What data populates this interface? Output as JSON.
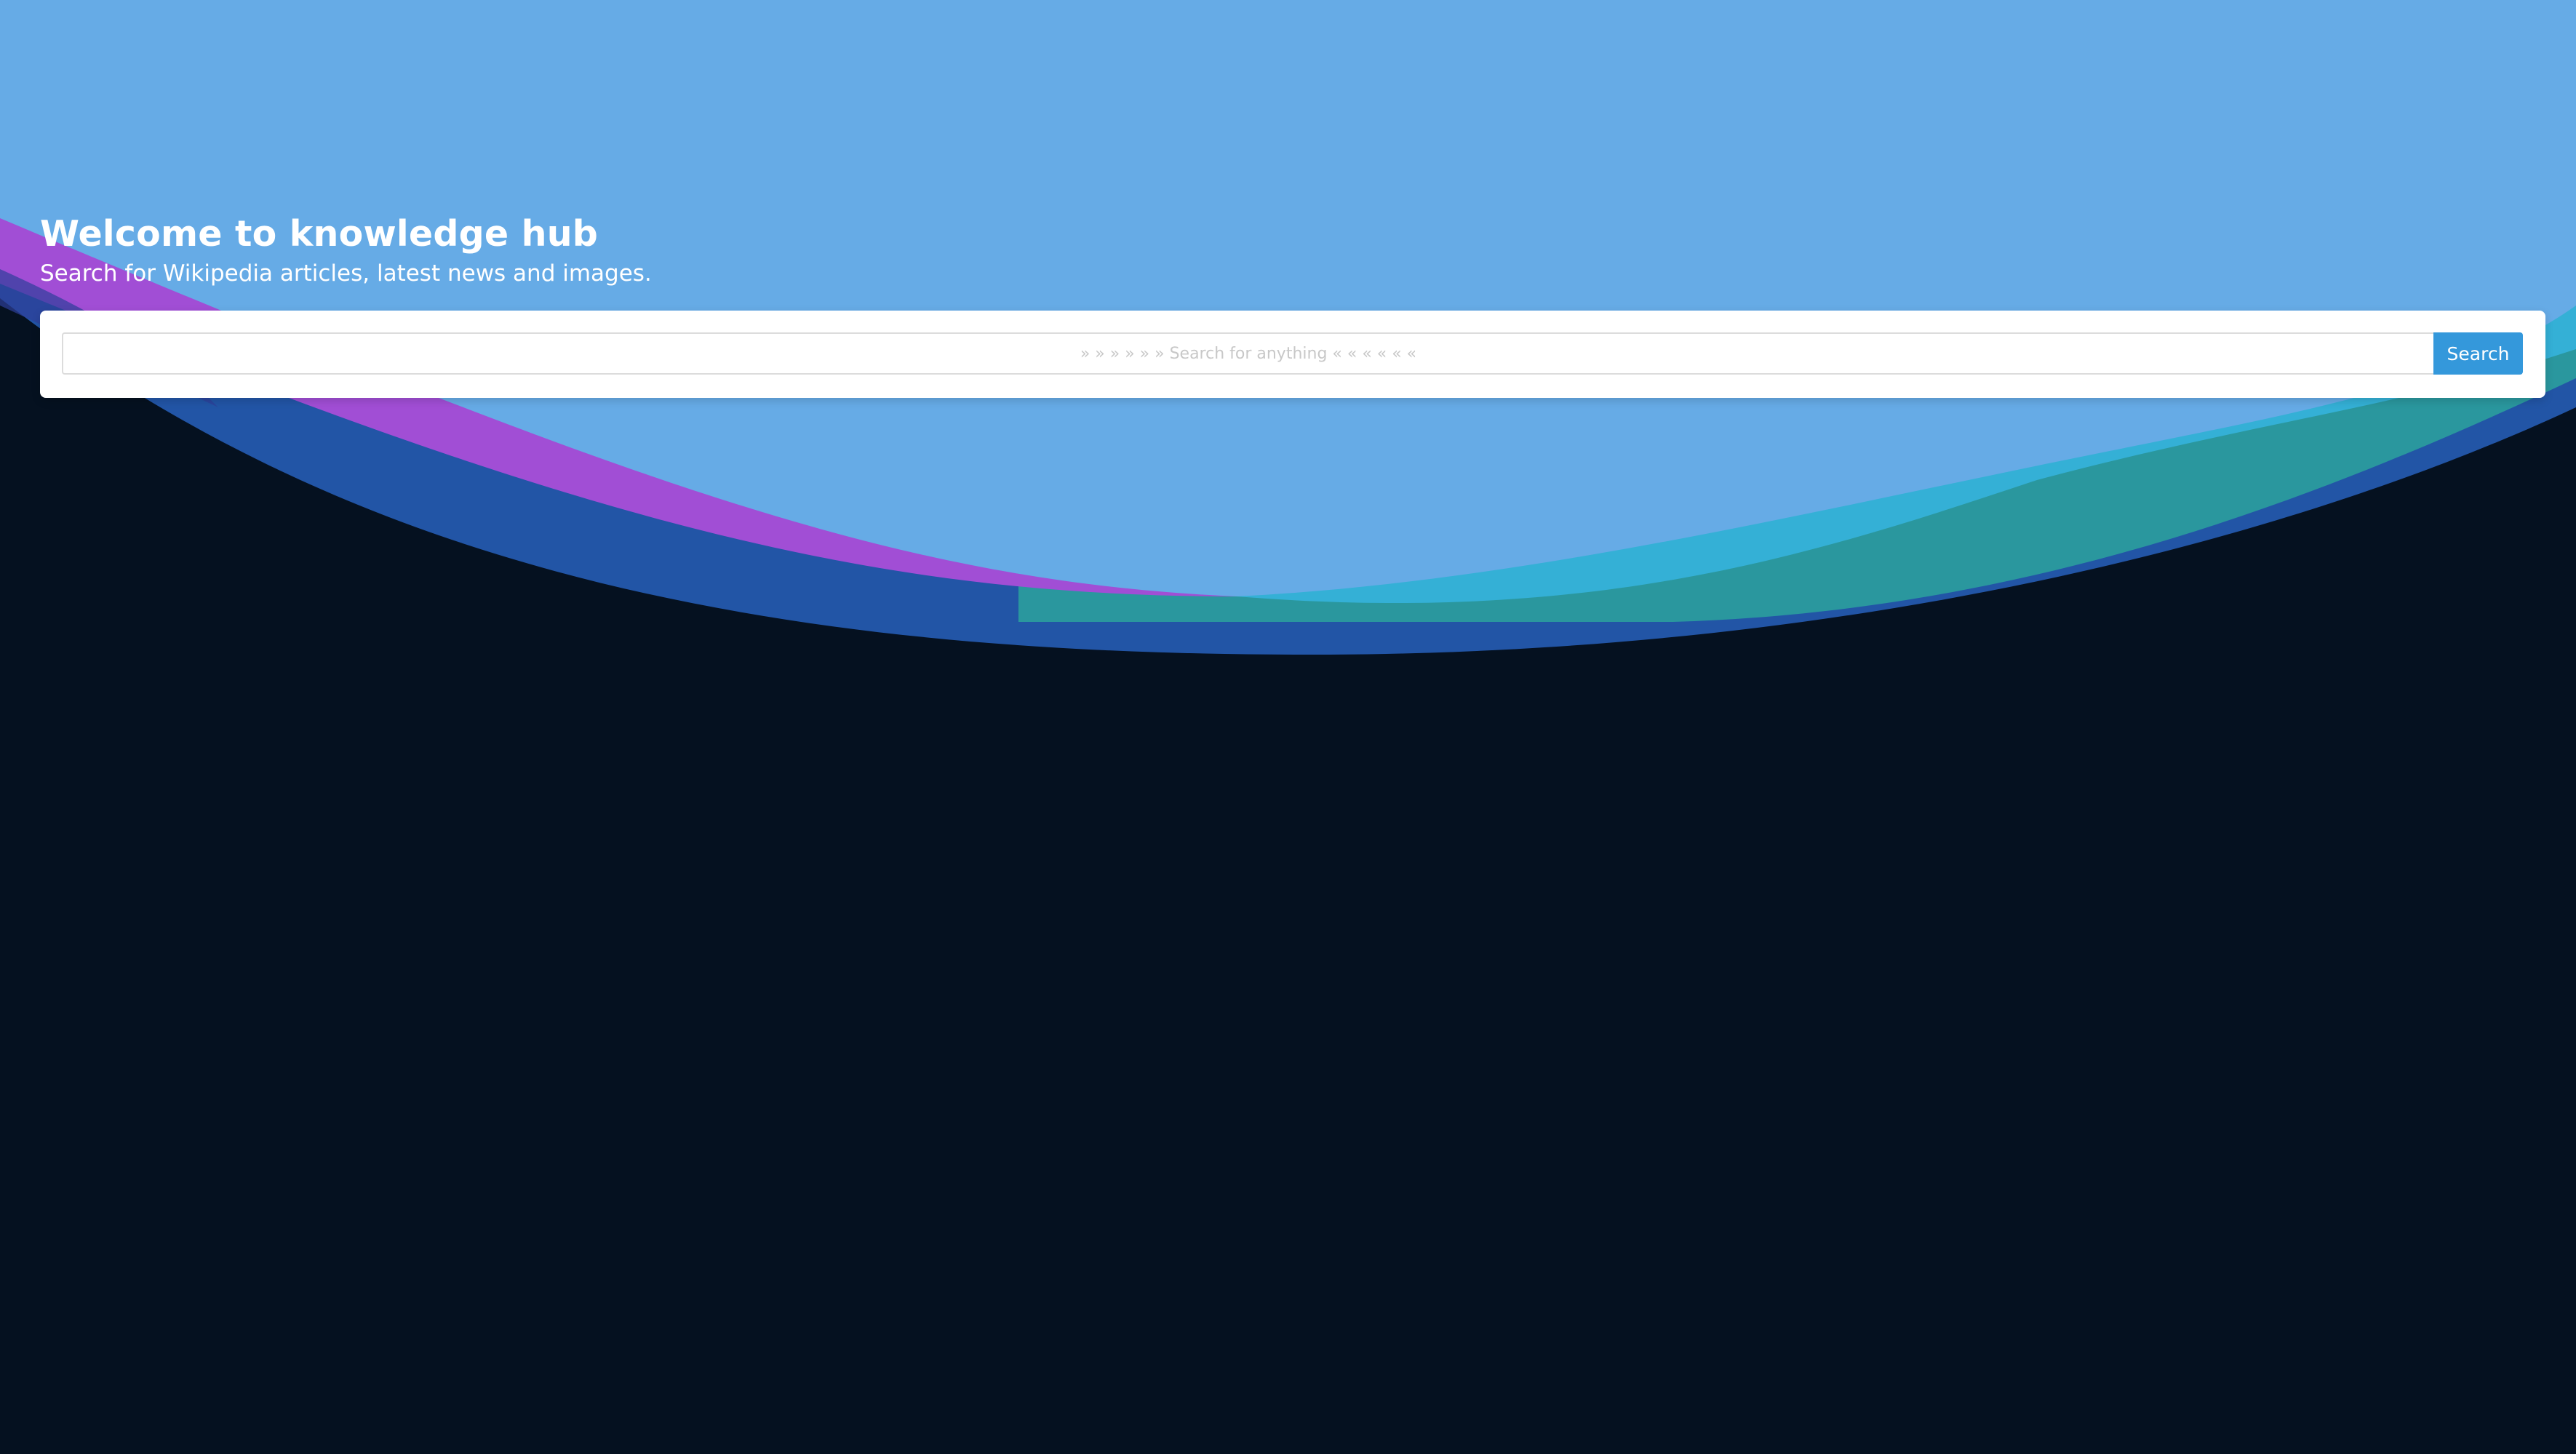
{
  "hero": {
    "title": "Welcome to knowledge hub",
    "subtitle": "Search for Wikipedia articles, latest news and images."
  },
  "search": {
    "placeholder": "» » » » » » Search for anything « « « « « «",
    "value": "",
    "button_label": "Search"
  },
  "colors": {
    "background_dark": "#051120",
    "sky_blue": "#66ABE6",
    "wave_purple": "#A14ED5",
    "wave_blue": "#2255A6",
    "wave_cyan": "#34B0D6",
    "wave_teal": "#2A979E",
    "button_accent": "#3498DB"
  }
}
